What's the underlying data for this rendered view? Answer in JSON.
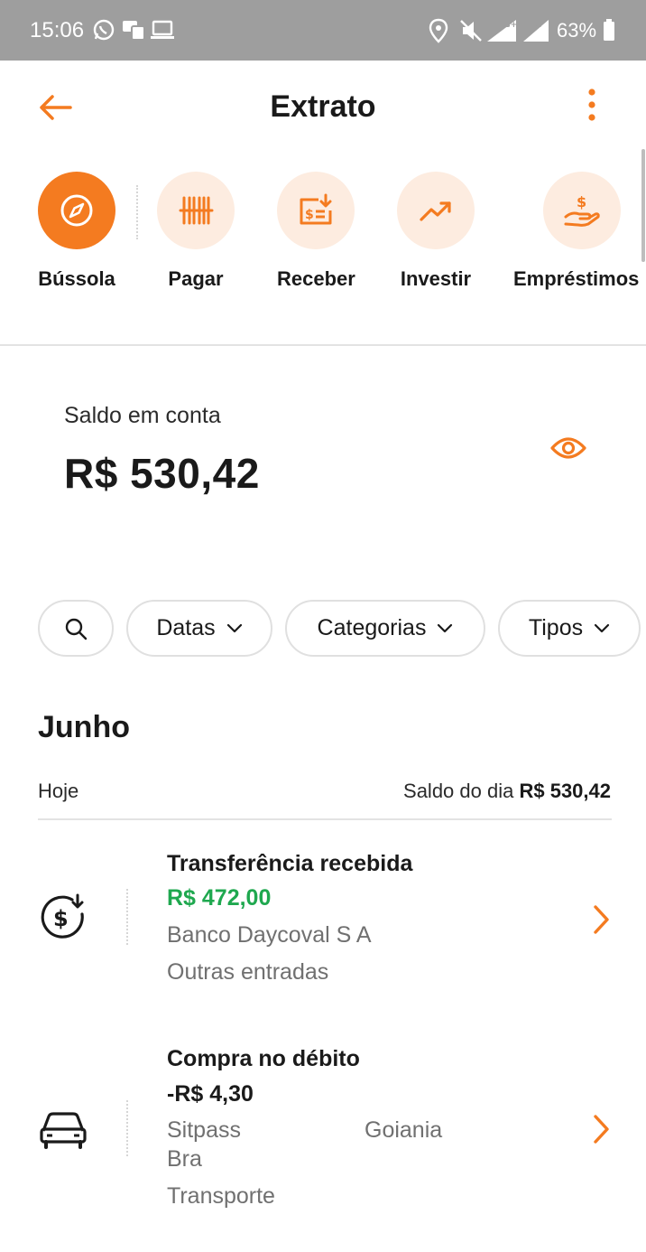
{
  "status_bar": {
    "time": "15:06",
    "battery": "63%"
  },
  "header": {
    "title": "Extrato"
  },
  "shortcuts": [
    {
      "label": "Bússola",
      "icon": "compass-icon",
      "active": true
    },
    {
      "label": "Pagar",
      "icon": "barcode-icon",
      "active": false
    },
    {
      "label": "Receber",
      "icon": "receive-money-icon",
      "active": false
    },
    {
      "label": "Investir",
      "icon": "trending-up-icon",
      "active": false
    },
    {
      "label": "Empréstimos",
      "icon": "loan-hand-icon",
      "active": false
    }
  ],
  "balance": {
    "label": "Saldo em conta",
    "value": "R$ 530,42"
  },
  "filters": {
    "dates": "Datas",
    "categories": "Categorias",
    "types": "Tipos"
  },
  "month": "Junho",
  "day": {
    "label": "Hoje",
    "balance_label": "Saldo do dia",
    "balance_value": "R$ 530,42"
  },
  "transactions": [
    {
      "title": "Transferência recebida",
      "amount": "R$ 472,00",
      "amount_color": "#1fa84f",
      "line1": "Banco Daycoval S A",
      "line2": "Outras entradas",
      "icon": "money-in-icon"
    },
    {
      "title": "Compra no débito",
      "amount": "-R$ 4,30",
      "amount_color": "#1a1a1a",
      "line1": "Sitpass",
      "line1b": "Goiania",
      "line2": "Bra",
      "line3": "Transporte",
      "icon": "car-icon"
    }
  ],
  "colors": {
    "accent": "#f47b20",
    "accent_light": "#fdece0",
    "positive": "#1fa84f"
  }
}
